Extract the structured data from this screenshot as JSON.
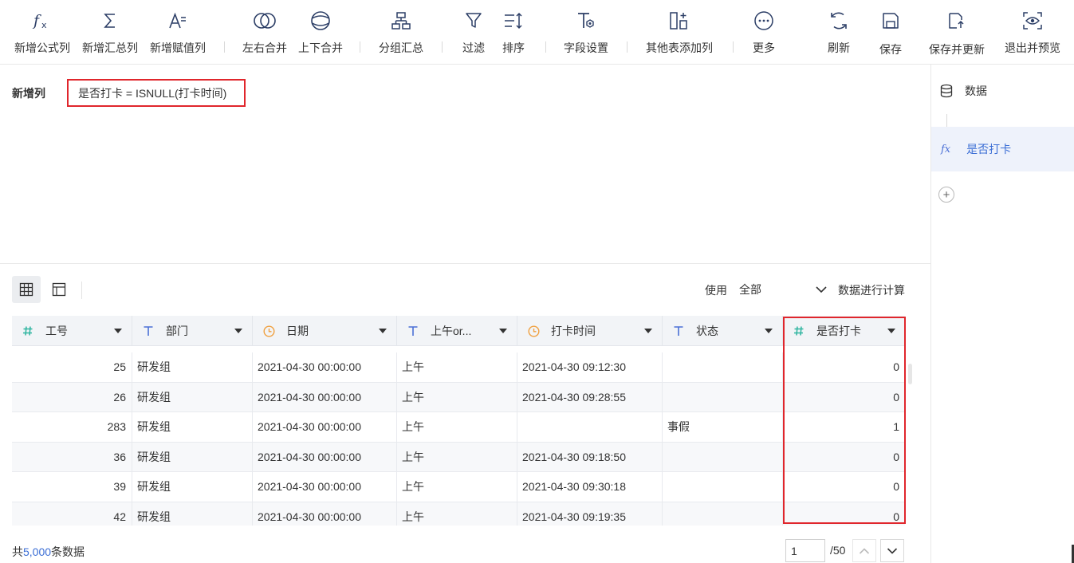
{
  "toolbar": {
    "items": [
      {
        "label": "新增公式列",
        "icon": "formula-icon"
      },
      {
        "label": "新增汇总列",
        "icon": "sum-icon"
      },
      {
        "label": "新增赋值列",
        "icon": "assign-icon"
      },
      {
        "label": "左右合并",
        "icon": "merge-horizontal-icon"
      },
      {
        "label": "上下合并",
        "icon": "merge-vertical-icon"
      },
      {
        "label": "分组汇总",
        "icon": "group-icon"
      },
      {
        "label": "过滤",
        "icon": "filter-icon"
      },
      {
        "label": "排序",
        "icon": "sort-icon"
      },
      {
        "label": "字段设置",
        "icon": "field-settings-icon"
      },
      {
        "label": "其他表添加列",
        "icon": "add-column-icon"
      },
      {
        "label": "更多",
        "icon": "more-icon"
      },
      {
        "label": "刷新",
        "icon": "refresh-icon"
      },
      {
        "label": "保存",
        "icon": "save-icon"
      },
      {
        "label": "保存并更新",
        "icon": "save-update-icon"
      },
      {
        "label": "退出并预览",
        "icon": "preview-icon"
      }
    ]
  },
  "formula": {
    "label": "新增列",
    "expression": "是否打卡 = ISNULL(打卡时间)"
  },
  "right_panel": {
    "data_label": "数据",
    "step_label": "是否打卡",
    "step_icon": "fx",
    "add_symbol": "+"
  },
  "options": {
    "use_label": "使用",
    "scope_value": "全部",
    "suffix": "数据进行计算"
  },
  "table": {
    "columns": [
      {
        "name": "工号",
        "type": "#"
      },
      {
        "name": "部门",
        "type": "T"
      },
      {
        "name": "日期",
        "type": "clock"
      },
      {
        "name": "上午or...",
        "type": "T"
      },
      {
        "name": "打卡时间",
        "type": "clock"
      },
      {
        "name": "状态",
        "type": "T"
      },
      {
        "name": "是否打卡",
        "type": "#"
      }
    ],
    "rows": [
      [
        "25",
        "研发组",
        "2021-04-30 00:00:00",
        "上午",
        "2021-04-30 09:12:30",
        "",
        "0"
      ],
      [
        "26",
        "研发组",
        "2021-04-30 00:00:00",
        "上午",
        "2021-04-30 09:28:55",
        "",
        "0"
      ],
      [
        "283",
        "研发组",
        "2021-04-30 00:00:00",
        "上午",
        "",
        "事假",
        "1"
      ],
      [
        "36",
        "研发组",
        "2021-04-30 00:00:00",
        "上午",
        "2021-04-30 09:18:50",
        "",
        "0"
      ],
      [
        "39",
        "研发组",
        "2021-04-30 00:00:00",
        "上午",
        "2021-04-30 09:30:18",
        "",
        "0"
      ],
      [
        "42",
        "研发组",
        "2021-04-30 00:00:00",
        "上午",
        "2021-04-30 09:19:35",
        "",
        "0"
      ]
    ]
  },
  "footer": {
    "total_prefix": "共",
    "total_count": "5,000",
    "total_suffix": "条数据",
    "page_value": "1",
    "page_total": "/50"
  },
  "colors": {
    "accent": "#3b6ed5",
    "highlight": "#e0262c",
    "number_type": "#2fb5a0",
    "text_type": "#4a6fd6",
    "date_type": "#f0a040"
  }
}
